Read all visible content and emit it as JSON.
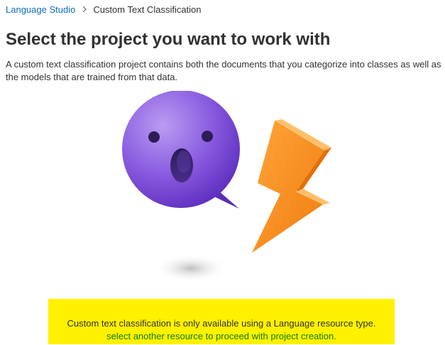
{
  "breadcrumb": {
    "root": "Language Studio",
    "current": "Custom Text Classification"
  },
  "page": {
    "title": "Select the project you want to work with",
    "description": "A custom text classification project contains both the documents that you categorize into classes as well as the models that are trained from that data."
  },
  "illustration": {
    "icons": [
      "surprised-speech-bubble-icon",
      "lightning-bolt-icon"
    ],
    "colors": {
      "bubble": "#7b4fd6",
      "bolt": "#f7941d"
    }
  },
  "notice": {
    "message": "Custom text classification is only available using a Language resource type.",
    "link_text": "select another resource to proceed with project creation.",
    "background": "#fff100",
    "link_color": "#107c10"
  },
  "colors": {
    "link": "#0f6cbd",
    "text": "#323130"
  }
}
